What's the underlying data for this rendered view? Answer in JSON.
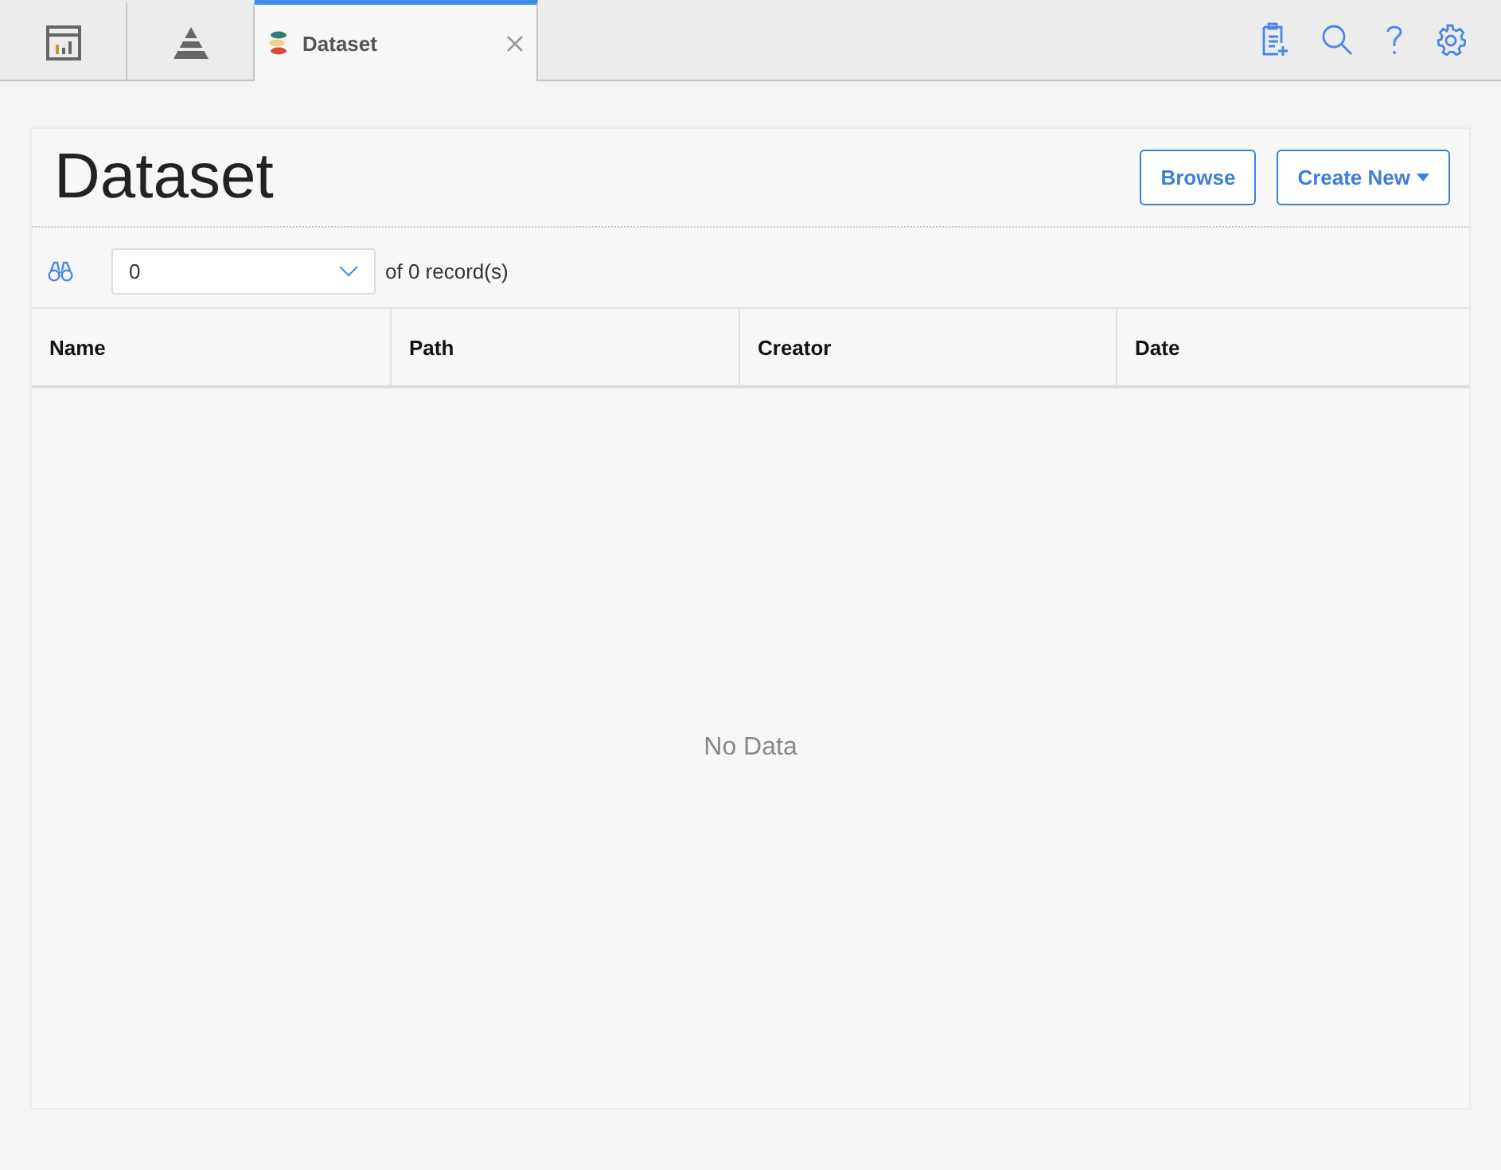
{
  "tabs": [
    {
      "kind": "icon",
      "selected": false
    },
    {
      "kind": "icon2",
      "selected": false
    },
    {
      "kind": "label",
      "label": "Dataset",
      "selected": true
    }
  ],
  "page": {
    "title": "Dataset",
    "buttons": [
      {
        "label": "Browse",
        "dropdown": false
      },
      {
        "label": "Create New",
        "dropdown": true
      }
    ]
  },
  "pager": {
    "value": "0",
    "summary": "of 0 record(s)"
  },
  "table": {
    "columns": [
      "Name",
      "Path",
      "Creator",
      "Date"
    ],
    "empty_text": "No Data"
  }
}
